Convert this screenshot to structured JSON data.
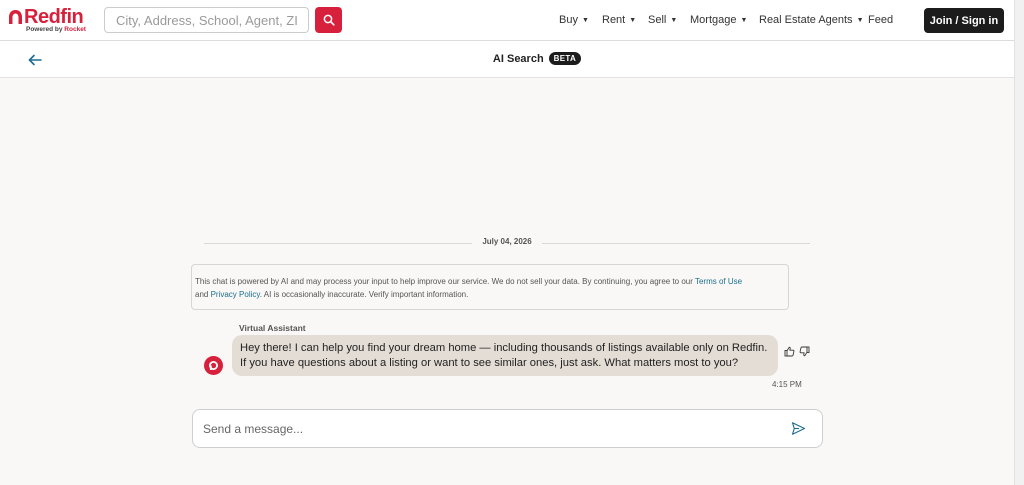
{
  "header": {
    "logo_word": "Redfin",
    "logo_sub_prefix": "Powered by",
    "logo_sub_brand": "Rocket",
    "search_placeholder": "City, Address, School, Agent, ZIP",
    "nav": [
      {
        "label": "Buy",
        "has_caret": true
      },
      {
        "label": "Rent",
        "has_caret": true
      },
      {
        "label": "Sell",
        "has_caret": true
      },
      {
        "label": "Mortgage",
        "has_caret": true
      },
      {
        "label": "Real Estate Agents",
        "has_caret": true
      },
      {
        "label": "Feed",
        "has_caret": false
      }
    ],
    "join_label": "Join / Sign in"
  },
  "subheader": {
    "title": "AI Search",
    "badge": "BETA"
  },
  "chat": {
    "date": "July 04, 2026",
    "disclaimer": {
      "text_1": "This chat is powered by AI and may process your input to help improve our service. We do not sell your data. By continuing, you agree to our ",
      "terms_link": "Terms of Use",
      "text_2": " and ",
      "privacy_link": "Privacy Policy",
      "text_3": ". AI is occasionally inaccurate. Verify important information."
    },
    "sender": "Virtual Assistant",
    "message": "Hey there! I can help you find your dream home — including thousands of listings available only on Redfin. If you have questions about a listing or want to see similar ones, just ask. What matters most to you?",
    "time": "4:15 PM",
    "composer_placeholder": "Send a message..."
  },
  "colors": {
    "brand_red": "#d7203c",
    "link_teal": "#1b6e8f",
    "bubble_bg": "#e4ddd6",
    "dark_button": "#1c1c1c"
  },
  "icons": [
    "redfin-logo-icon",
    "search-icon",
    "back-arrow-icon",
    "thumbs-up-icon",
    "thumbs-down-icon",
    "send-icon",
    "redfin-avatar-icon"
  ]
}
